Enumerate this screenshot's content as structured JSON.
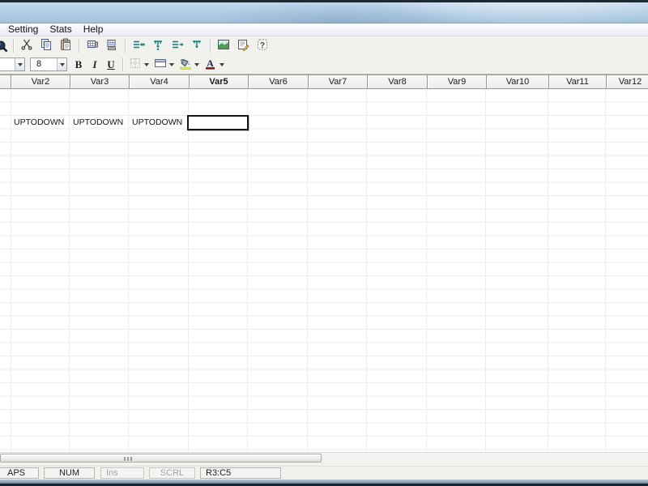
{
  "menu": {
    "items": [
      {
        "label": "Setting"
      },
      {
        "label": "Stats"
      },
      {
        "label": "Help"
      }
    ]
  },
  "toolbar_main": {
    "icons": [
      "clipped-icon",
      "cut-icon",
      "copy-icon",
      "paste-icon",
      "insert-table-icon",
      "append-table-icon",
      "insert-variable-icon",
      "insert-case-icon",
      "append-variable-icon",
      "append-case-icon",
      "chart-icon",
      "properties-icon",
      "help-icon"
    ]
  },
  "toolbar_format": {
    "font_size": "8",
    "bold_label": "B",
    "italic_label": "I",
    "underline_label": "U",
    "fill_accent": "#dce94e",
    "font_color_accent": "#7a1f1f"
  },
  "sheet": {
    "columns": [
      "Var2",
      "Var3",
      "Var4",
      "Var5",
      "Var6",
      "Var7",
      "Var8",
      "Var9",
      "Var10",
      "Var11",
      "Var12"
    ],
    "selected_column": "Var5",
    "data_cells": [
      {
        "row": 3,
        "column": "Var2",
        "text": "UPTODOWN"
      },
      {
        "row": 3,
        "column": "Var3",
        "text": "UPTODOWN"
      },
      {
        "row": 3,
        "column": "Var4",
        "text": "UPTODOWN"
      }
    ],
    "selection": {
      "cell_ref": "R3:C5"
    }
  },
  "statusbar": {
    "caps_label": "APS",
    "num_label": "NUM",
    "ins_label": "Ins",
    "scrl_label": "SCRL",
    "cell_ref": "R3:C5"
  },
  "colors": {
    "titlebar": "#aecbe4",
    "teal_icon": "#0c7c7c",
    "selection_border": "#161616"
  }
}
